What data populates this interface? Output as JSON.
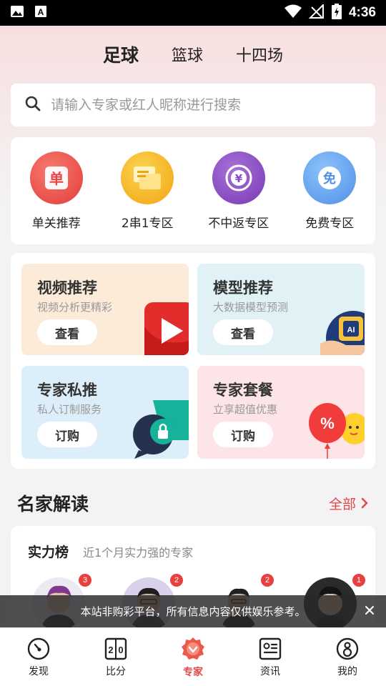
{
  "status_bar": {
    "time": "4:36"
  },
  "sport_tabs": [
    {
      "label": "足球",
      "active": true
    },
    {
      "label": "篮球",
      "active": false
    },
    {
      "label": "十四场",
      "active": false
    }
  ],
  "search": {
    "placeholder": "请输入专家或红人昵称进行搜索",
    "value": ""
  },
  "quick_entries": [
    {
      "label": "单关推荐",
      "icon": "single-icon",
      "glyph": "单",
      "color": "#e84545"
    },
    {
      "label": "2串1专区",
      "icon": "card-stack-icon",
      "glyph": "",
      "color": "#f5b41e"
    },
    {
      "label": "不中返专区",
      "icon": "yen-coin-icon",
      "glyph": "¥",
      "color": "#8a4bc4"
    },
    {
      "label": "免费专区",
      "icon": "free-icon",
      "glyph": "免",
      "color": "#4f8fe8"
    }
  ],
  "promo_cards": [
    {
      "title": "视频推荐",
      "subtitle": "视频分析更精彩",
      "button": "查看",
      "bg": "#fcebd9"
    },
    {
      "title": "模型推荐",
      "subtitle": "大数据模型预测",
      "button": "查看",
      "bg": "#e0f2f5"
    },
    {
      "title": "专家私推",
      "subtitle": "私人订制服务",
      "button": "订购",
      "bg": "#ddeefb"
    },
    {
      "title": "专家套餐",
      "subtitle": "立享超值优惠",
      "button": "订购",
      "bg": "#fde4e6"
    }
  ],
  "experts_section": {
    "title": "名家解读",
    "more": "全部"
  },
  "rank": {
    "title": "实力榜",
    "subtitle": "近1个月实力强的专家",
    "experts": [
      {
        "badge": "3"
      },
      {
        "badge": "2"
      },
      {
        "badge": "2"
      },
      {
        "badge": "1"
      }
    ]
  },
  "toast": {
    "text": "本站非购彩平台，所有信息内容仅供娱乐参考。"
  },
  "bottom_nav": [
    {
      "label": "发现",
      "icon": "compass-icon",
      "active": false
    },
    {
      "label": "比分",
      "icon": "scoreboard-icon",
      "active": false
    },
    {
      "label": "专家",
      "icon": "expert-badge-icon",
      "active": true
    },
    {
      "label": "资讯",
      "icon": "news-icon",
      "active": false
    },
    {
      "label": "我的",
      "icon": "profile-icon",
      "active": false
    }
  ],
  "colors": {
    "accent": "#e04848",
    "highlight": "#f7d740"
  }
}
